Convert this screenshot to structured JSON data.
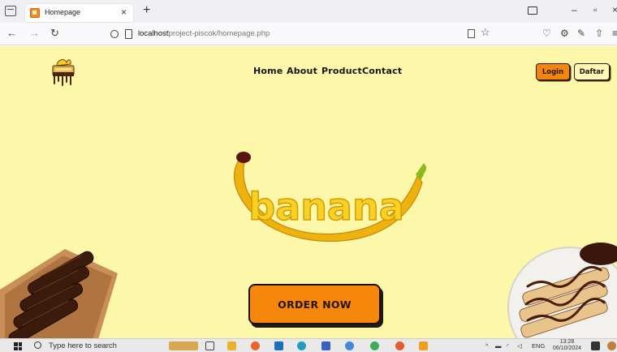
{
  "browser": {
    "tab_title": "Homepage",
    "url_host": "localhost",
    "url_path": "/project-piscok/homepage.php"
  },
  "site": {
    "nav": [
      "Home",
      "About",
      "Product",
      "Contact"
    ],
    "login_label": "Login",
    "daftar_label": "Daftar",
    "hero_word": "banana",
    "order_label": "ORDER NOW"
  },
  "taskbar": {
    "search_placeholder": "Type here to search",
    "language": "ENG",
    "time": "13:28",
    "date": "06/10/2024"
  },
  "colors": {
    "page_bg": "#fdf8a9",
    "accent": "#f7860d",
    "chocolate": "#4a2512",
    "banana": "#f6cc1e"
  },
  "icons": [
    "tab-list-icon",
    "close-icon",
    "new-tab-icon",
    "back-icon",
    "forward-icon",
    "reload-icon",
    "shield-icon",
    "page-icon",
    "reader-icon",
    "star-icon",
    "pocket-icon",
    "extensions-icon",
    "share-icon",
    "menu-icon",
    "windows-start-icon",
    "search-icon"
  ]
}
